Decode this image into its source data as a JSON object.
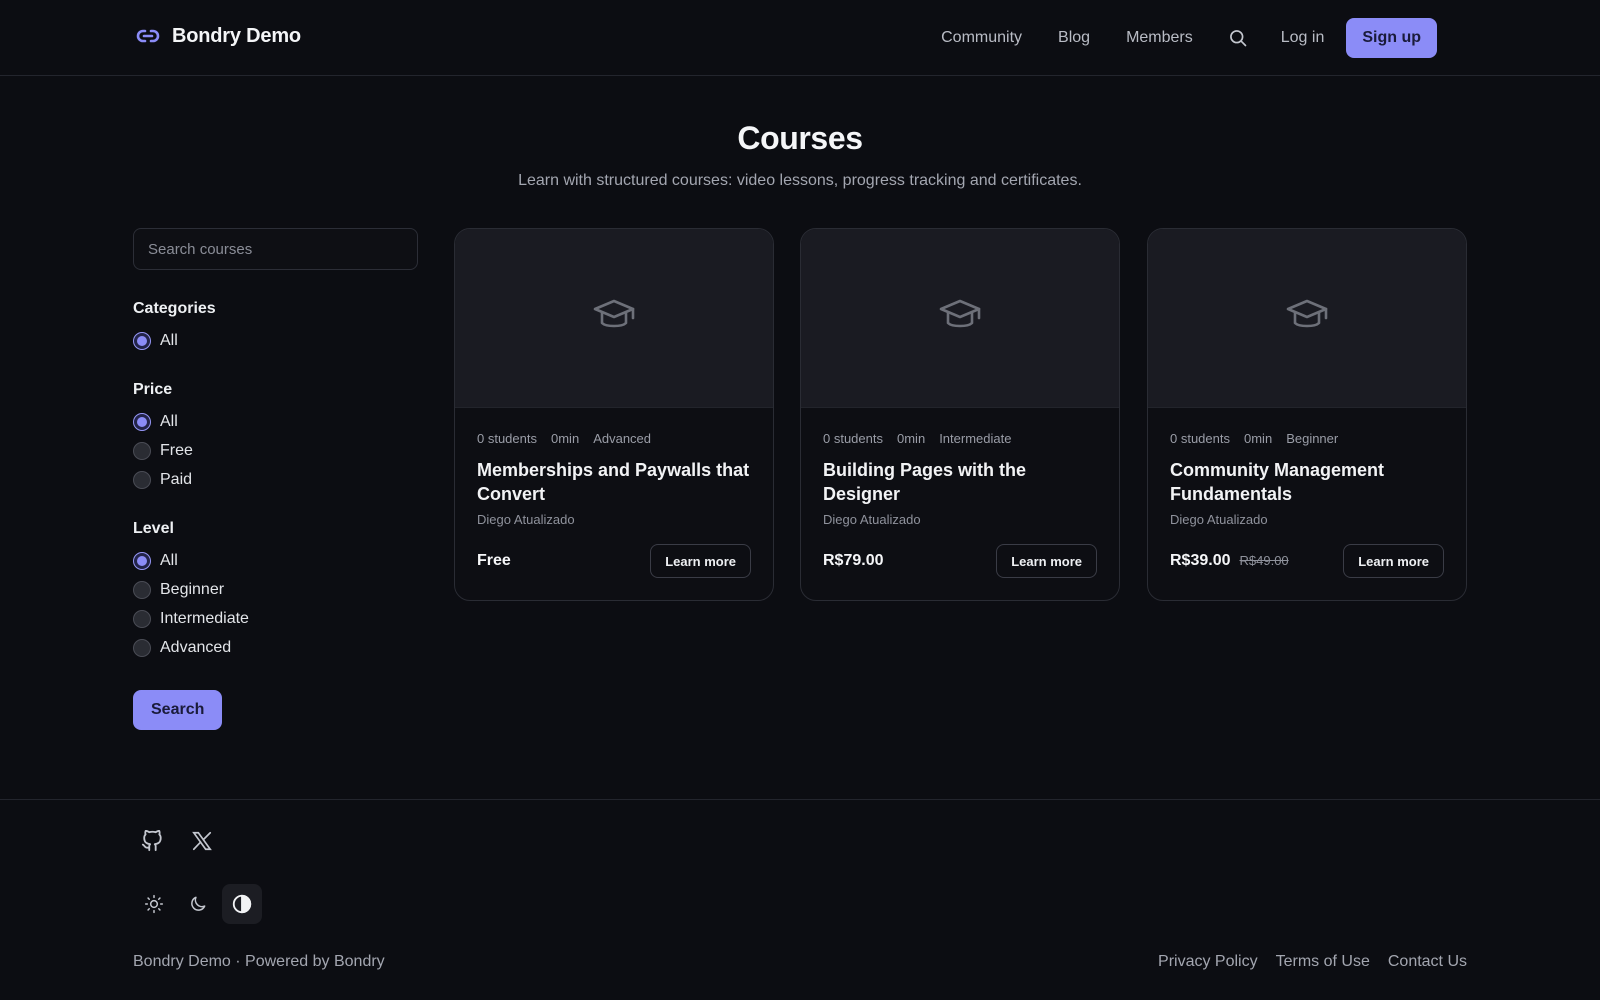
{
  "header": {
    "brand": "Bondry Demo",
    "nav": [
      "Community",
      "Blog",
      "Members"
    ],
    "login_label": "Log in",
    "signup_label": "Sign up"
  },
  "hero": {
    "title": "Courses",
    "subtitle": "Learn with structured courses: video lessons, progress tracking and certificates."
  },
  "sidebar": {
    "search_placeholder": "Search courses",
    "categories": {
      "title": "Categories",
      "options": [
        "All"
      ],
      "selected": "All"
    },
    "price": {
      "title": "Price",
      "options": [
        "All",
        "Free",
        "Paid"
      ],
      "selected": "All"
    },
    "level": {
      "title": "Level",
      "options": [
        "All",
        "Beginner",
        "Intermediate",
        "Advanced"
      ],
      "selected": "All"
    },
    "search_button": "Search"
  },
  "courses": [
    {
      "students": "0 students",
      "duration": "0min",
      "level": "Advanced",
      "title": "Memberships and Paywalls that Convert",
      "author": "Diego Atualizado",
      "price": "Free",
      "old_price": "",
      "cta": "Learn more"
    },
    {
      "students": "0 students",
      "duration": "0min",
      "level": "Intermediate",
      "title": "Building Pages with the Designer",
      "author": "Diego Atualizado",
      "price": "R$79.00",
      "old_price": "",
      "cta": "Learn more"
    },
    {
      "students": "0 students",
      "duration": "0min",
      "level": "Beginner",
      "title": "Community Management Fundamentals",
      "author": "Diego Atualizado",
      "price": "R$39.00",
      "old_price": "R$49.00",
      "cta": "Learn more"
    }
  ],
  "footer": {
    "social_icons": [
      "github-icon",
      "x-icon"
    ],
    "theme_icons": [
      "sun-icon",
      "moon-icon",
      "contrast-icon"
    ],
    "active_theme": "contrast-icon",
    "copyright": "Bondry Demo · Powered by Bondry",
    "links": [
      "Privacy Policy",
      "Terms of Use",
      "Contact Us"
    ]
  },
  "colors": {
    "accent": "#8b8cf7",
    "background": "#0c0d12"
  }
}
